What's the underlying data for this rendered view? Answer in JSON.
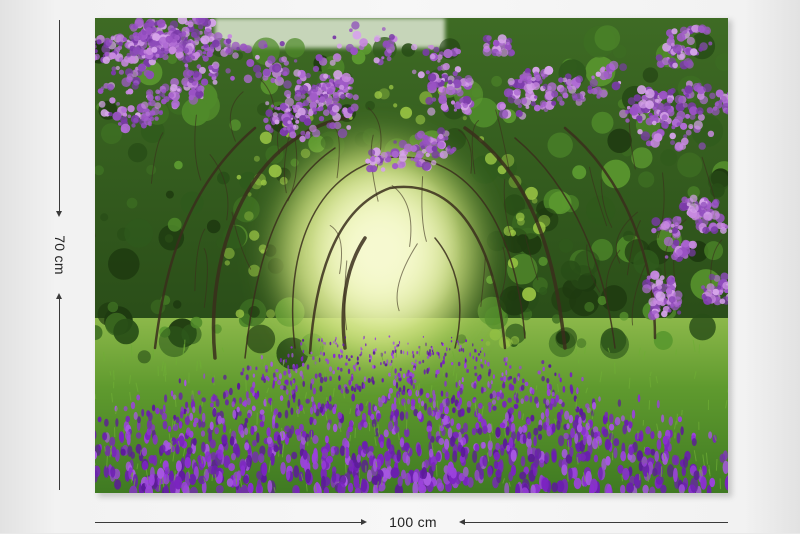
{
  "product": {
    "height_label": "70 cm",
    "width_label": "100 cm"
  },
  "scene": {
    "subject": "flower-tunnel-photo",
    "colors": {
      "lilac": "#b06cd4",
      "lilac_dark": "#7a3aa8",
      "violet_flowers": "#8a2fd0",
      "foliage": "#2f5a1c",
      "grass": "#5f9a2e",
      "light": "#f3f7c8"
    }
  },
  "icons": [
    "arrow-down-icon",
    "arrow-up-icon",
    "arrow-right-icon",
    "arrow-left-icon"
  ]
}
